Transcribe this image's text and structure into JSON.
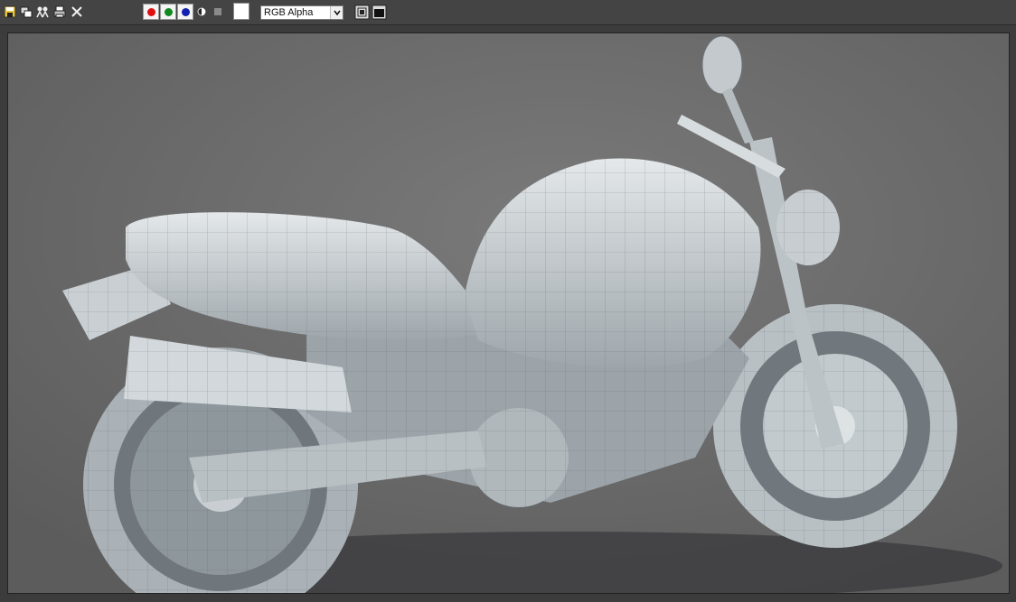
{
  "toolbar": {
    "tools": [
      {
        "icon": "save-icon"
      },
      {
        "icon": "clone-icon"
      },
      {
        "icon": "channels-icon"
      },
      {
        "icon": "print-icon"
      },
      {
        "icon": "close-icon"
      }
    ],
    "channels": [
      {
        "name": "red",
        "color": "#e01010"
      },
      {
        "name": "green",
        "color": "#108a20"
      },
      {
        "name": "blue",
        "color": "#1020b0"
      }
    ],
    "swatch_color": "#ffffff",
    "display_mode": "RGB Alpha"
  },
  "viewport": {
    "background": "#6b6b6b",
    "model_color": "#c7cdd1"
  }
}
